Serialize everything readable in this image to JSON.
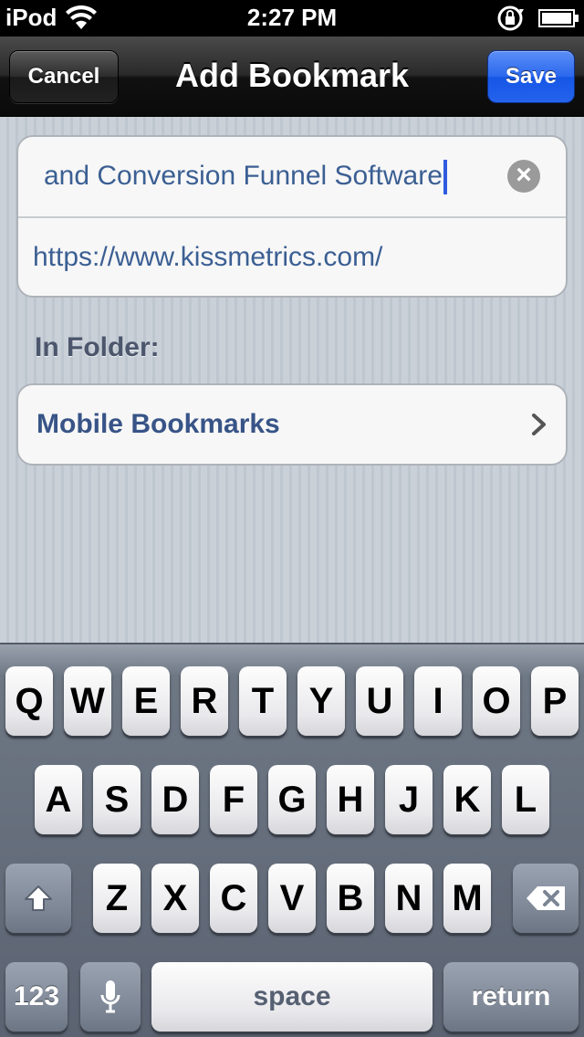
{
  "status_bar": {
    "carrier": "iPod",
    "time": "2:27 PM"
  },
  "nav": {
    "title": "Add Bookmark",
    "cancel_label": "Cancel",
    "save_label": "Save"
  },
  "form": {
    "title_value": "and Conversion Funnel Software",
    "url_value": "https://www.kissmetrics.com/",
    "clear_icon": "clear-icon"
  },
  "folder": {
    "section_label": "In Folder:",
    "value": "Mobile Bookmarks"
  },
  "keyboard": {
    "row1": [
      "Q",
      "W",
      "E",
      "R",
      "T",
      "Y",
      "U",
      "I",
      "O",
      "P"
    ],
    "row2": [
      "A",
      "S",
      "D",
      "F",
      "G",
      "H",
      "J",
      "K",
      "L"
    ],
    "row3": [
      "Z",
      "X",
      "C",
      "V",
      "B",
      "N",
      "M"
    ],
    "numbers_label": "123",
    "space_label": "space",
    "return_label": "return"
  },
  "colors": {
    "accent_blue": "#2b68ee",
    "link_text": "#3b5f93"
  }
}
